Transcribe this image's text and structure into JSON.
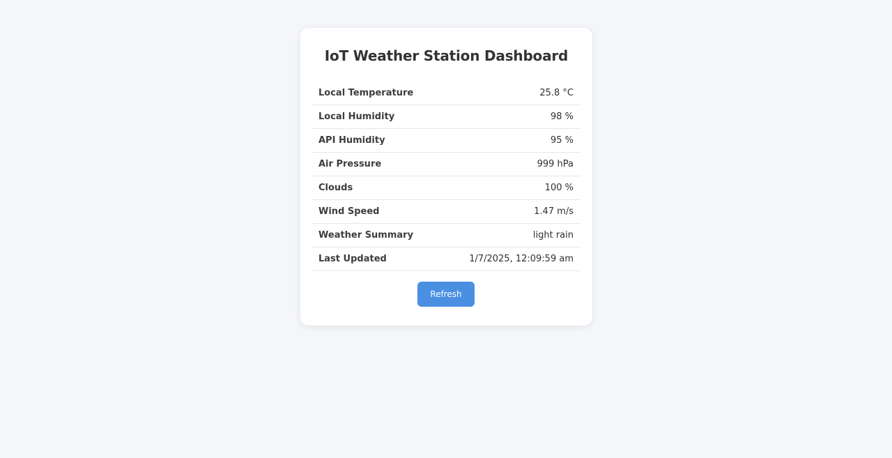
{
  "dashboard": {
    "title": "IoT Weather Station Dashboard",
    "rows": [
      {
        "label": "Local Temperature",
        "value": "25.8 °C"
      },
      {
        "label": "Local Humidity",
        "value": "98 %"
      },
      {
        "label": "API Humidity",
        "value": "95 %"
      },
      {
        "label": "Air Pressure",
        "value": "999 hPa"
      },
      {
        "label": "Clouds",
        "value": "100 %"
      },
      {
        "label": "Wind Speed",
        "value": "1.47 m/s"
      },
      {
        "label": "Weather Summary",
        "value": "light rain"
      },
      {
        "label": "Last Updated",
        "value": "1/7/2025, 12:09:59 am"
      }
    ],
    "refresh_label": "Refresh"
  },
  "colors": {
    "background": "#f4f6fa",
    "card": "#ffffff",
    "accent": "#4a8fe2"
  }
}
